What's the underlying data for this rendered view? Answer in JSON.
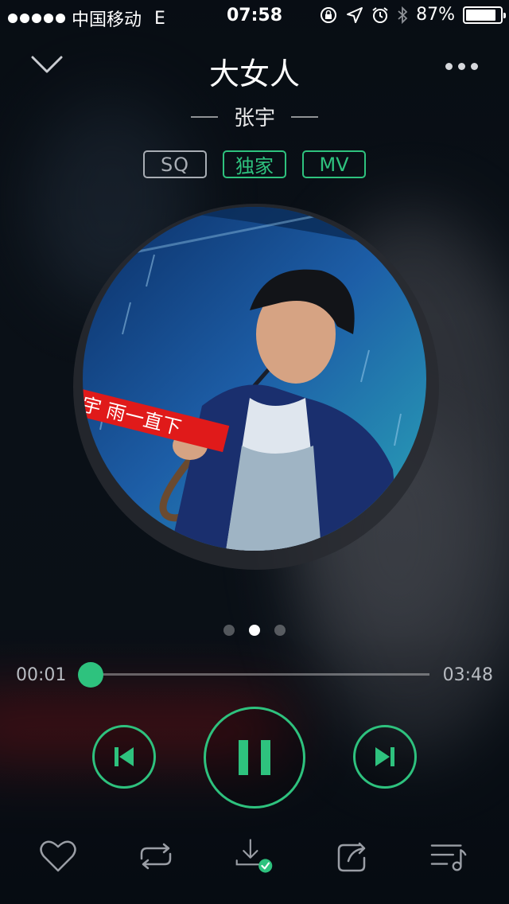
{
  "status_bar": {
    "carrier": "中国移动",
    "network": "E",
    "time": "07:58",
    "battery_text": "87%",
    "battery_level": 0.87,
    "icons": [
      "orientation-lock-icon",
      "location-arrow-icon",
      "alarm-icon",
      "bluetooth-icon",
      "battery-icon"
    ]
  },
  "header": {
    "song_title": "大女人",
    "artist": "张宇",
    "collapse_icon": "chevron-down-icon",
    "more_icon": "more-dots-icon"
  },
  "tags": {
    "sq": "SQ",
    "exclusive": "独家",
    "mv": "MV"
  },
  "album_cover": {
    "banner_text": "宇 雨一直下"
  },
  "pager": {
    "count": 3,
    "active_index": 1
  },
  "progress": {
    "current_time": "00:01",
    "total_time": "03:48",
    "fraction": 0.004
  },
  "controls": {
    "previous_icon": "skip-previous-icon",
    "play_state_icon": "pause-icon",
    "next_icon": "skip-next-icon"
  },
  "toolbar": {
    "items": [
      "heart-icon",
      "repeat-icon",
      "download-done-icon",
      "share-icon",
      "playlist-icon"
    ]
  },
  "colors": {
    "accent": "#2ec27e",
    "background": "#0b1118",
    "muted_text": "#b8bcc2"
  }
}
